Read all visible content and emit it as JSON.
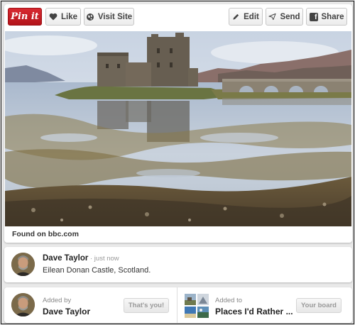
{
  "toolbar": {
    "pinit_label": "Pin it",
    "like_label": "Like",
    "visit_label": "Visit Site",
    "edit_label": "Edit",
    "send_label": "Send",
    "share_label": "Share"
  },
  "pin": {
    "image_alt": "Eilean Donan Castle reflected in a tidal loch",
    "found_on": "Found on bbc.com"
  },
  "description": {
    "user_name": "Dave Taylor",
    "time": " · just now",
    "text": "Eilean Donan Castle, Scotland."
  },
  "attribution": {
    "added_by_label": "Added by",
    "added_by_name": "Dave Taylor",
    "thats_you_label": "That's you!",
    "added_to_label": "Added to",
    "board_name": "Places I'd Rather ...",
    "your_board_label": "Your board"
  },
  "colors": {
    "pinterest_red": "#c8232c",
    "button_text": "#444444"
  }
}
